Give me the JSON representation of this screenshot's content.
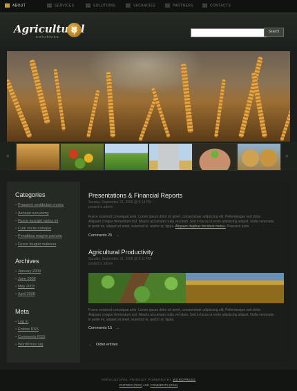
{
  "nav": {
    "items": [
      {
        "label": "ABOUT",
        "active": true
      },
      {
        "label": "SERVICES",
        "active": false
      },
      {
        "label": "SOLUTIONS",
        "active": false
      },
      {
        "label": "VACANCIES",
        "active": false
      },
      {
        "label": "PARTNERS",
        "active": false
      },
      {
        "label": "CONTACTS",
        "active": false
      }
    ]
  },
  "header": {
    "logo_text": "Agricultural",
    "logo_sub": "solutions",
    "search": {
      "placeholder": "",
      "button_label": "Search"
    }
  },
  "banner": {
    "prev_label": "«",
    "next_label": "»",
    "thumbnails": [
      "wheat",
      "vegetables",
      "green-field",
      "grain-silo",
      "seedling-hands",
      "hay-bales"
    ]
  },
  "sidebar": {
    "categories_title": "Categories",
    "categories": [
      "Praesent vestibulum moles",
      "Aenean nonummy",
      "Fusce suscipit varius mi",
      "Cum sociis natoque",
      "Penatibus magnis parturie",
      "Fusce feugiat malesua"
    ],
    "archives_title": "Archives",
    "archives": [
      "January 2009",
      "June 2008",
      "May 2003",
      "April 2008"
    ],
    "meta_title": "Meta",
    "meta": [
      "Log in",
      "Entries RSS",
      "Comments RSS",
      "WordPress.org"
    ]
  },
  "posts": [
    {
      "title": "Presentations & Financial Reports",
      "meta_line1": "Sunday, September 21, 2008 @ 5:14 PM",
      "meta_line2": "posted in admin",
      "body_lines": [
        "Fusce euismod consequat ante. Lorem ipsum dolor sit amet, consectetuer adipiscing elit. Pellentesque sed dolor.",
        "Aliquam congue fermentum nisl. Mauris accumsan nulla vel diam. Sed in lacus ut enim adipiscing aliquet. Nulla venenatis",
        "in pede mi, aliquet sit amet, euismod in, auctor ut, ligula."
      ],
      "body_link": "Aliquam dapibus tincidunt metus.",
      "body_tail": " Praesent justo",
      "comments": "Comments 25"
    },
    {
      "title": "Agricultural Productivity",
      "meta_line1": "Sunday, September 21, 2008 @ 5:11 PM",
      "meta_line2": "posted in admin",
      "body_lines": [
        "Fusce euismod consequat ante. Lorem ipsum dolor sit amet, consectetuer adipiscing elit. Pellentesque sed dolor.",
        "Aliquam congue fermentum nisl. Mauris accumsan nulla vel diam. Sed in lacus ut enim adipiscing aliquet. Nulla venenatis",
        "in pede mi, aliquet sit amet, euismod in, auctor ut, ligula."
      ],
      "comments": "Comments 15"
    }
  ],
  "older_entries": "Older entries",
  "footer": {
    "line1_text": "AGRICULTURAL PRODUCT POWERED BY ",
    "line1_link": "WORDPRESS",
    "line2_a": "ENTRIES (RSS)",
    "line2_sep": " AND ",
    "line2_b": "COMMENTS (RSS)"
  },
  "colors": {
    "accent": "#c79a3a",
    "bg": "#1b1e1b",
    "sidebar": "#262a25"
  }
}
